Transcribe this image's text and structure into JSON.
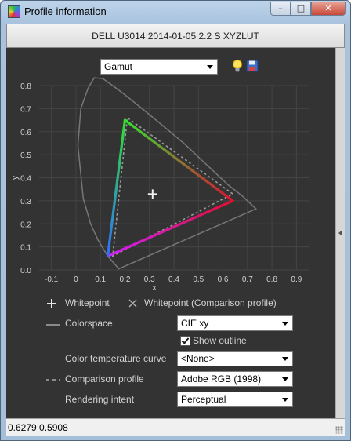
{
  "window": {
    "title": "Profile information",
    "buttons": {
      "minimize": "–",
      "maximize": "□",
      "close": "✕"
    }
  },
  "header": {
    "profile_name": "DELL U3014 2014-01-05 2.2 S XYZLUT"
  },
  "view_select": {
    "value": "Gamut"
  },
  "icons": {
    "help": "lightbulb-icon",
    "save": "floppy-disk-icon"
  },
  "chart_data": {
    "type": "scatter",
    "subtype": "CIE 1931 xy chromaticity gamut diagram",
    "xlabel": "x",
    "ylabel": "y",
    "xlim": [
      -0.15,
      0.95
    ],
    "ylim": [
      0.0,
      0.8
    ],
    "x_ticks": [
      "-0.1",
      "0",
      "0.1",
      "0.2",
      "0.3",
      "0.4",
      "0.5",
      "0.6",
      "0.7",
      "0.8",
      "0.9"
    ],
    "y_ticks": [
      "0.0",
      "0.1",
      "0.2",
      "0.3",
      "0.4",
      "0.5",
      "0.6",
      "0.7",
      "0.8"
    ],
    "grid": true,
    "gamut": {
      "red": {
        "x": 0.64,
        "y": 0.3
      },
      "green": {
        "x": 0.2,
        "y": 0.65
      },
      "blue": {
        "x": 0.13,
        "y": 0.06
      }
    },
    "comparison_gamut": {
      "red": {
        "x": 0.64,
        "y": 0.33
      },
      "green": {
        "x": 0.21,
        "y": 0.66
      },
      "blue": {
        "x": 0.15,
        "y": 0.06
      }
    },
    "whitepoint": {
      "x": 0.313,
      "y": 0.329
    },
    "colorspace_outline": [
      [
        0.175,
        0.005
      ],
      [
        0.13,
        0.06
      ],
      [
        0.09,
        0.13
      ],
      [
        0.06,
        0.2
      ],
      [
        0.03,
        0.31
      ],
      [
        0.008,
        0.54
      ],
      [
        0.02,
        0.7
      ],
      [
        0.05,
        0.79
      ],
      [
        0.075,
        0.834
      ],
      [
        0.11,
        0.83
      ],
      [
        0.15,
        0.8
      ],
      [
        0.2,
        0.76
      ],
      [
        0.27,
        0.7
      ],
      [
        0.35,
        0.63
      ],
      [
        0.44,
        0.55
      ],
      [
        0.54,
        0.45
      ],
      [
        0.62,
        0.37
      ],
      [
        0.68,
        0.32
      ],
      [
        0.735,
        0.265
      ]
    ]
  },
  "legend": {
    "whitepoint": "Whitepoint",
    "whitepoint_comparison": "Whitepoint (Comparison profile)",
    "colorspace_label": "Colorspace",
    "colorspace_value": "CIE xy",
    "show_outline": "Show outline",
    "show_outline_checked": true,
    "color_temp_label": "Color temperature curve",
    "color_temp_value": "<None>",
    "comparison_label": "Comparison profile",
    "comparison_value": "Adobe RGB (1998)",
    "intent_label": "Rendering intent",
    "intent_value": "Perceptual"
  },
  "status": {
    "cursor": "0.6279 0.5908"
  },
  "colors": {
    "panel_bg": "#333333",
    "grid": "#444444",
    "text": "#d2d2d2",
    "outline": "#777777",
    "red": "#e01030",
    "green": "#30e030",
    "blue": "#3070ff",
    "magenta": "#d020ff"
  }
}
